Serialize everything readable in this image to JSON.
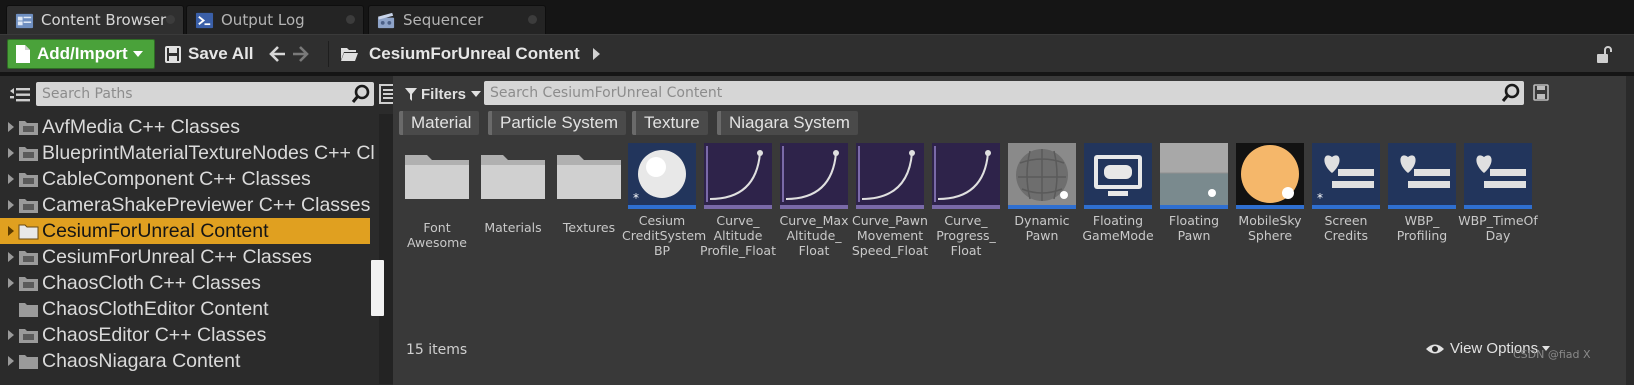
{
  "tabs": [
    {
      "label": "Content Browser",
      "active": true,
      "icon": "content-browser-icon"
    },
    {
      "label": "Output Log",
      "active": false,
      "icon": "output-log-icon"
    },
    {
      "label": "Sequencer",
      "active": false,
      "icon": "sequencer-icon"
    }
  ],
  "toolbar": {
    "add_import_label": "Add/Import",
    "save_all_label": "Save All",
    "breadcrumb": "CesiumForUnreal Content"
  },
  "path_panel": {
    "search_placeholder": "Search Paths",
    "items": [
      {
        "label": "AvfMedia C++ Classes",
        "type": "class",
        "expandable": true
      },
      {
        "label": "BlueprintMaterialTextureNodes C++ Cl",
        "type": "class",
        "expandable": true
      },
      {
        "label": "CableComponent C++ Classes",
        "type": "class",
        "expandable": true
      },
      {
        "label": "CameraShakePreviewer C++ Classes",
        "type": "class",
        "expandable": true
      },
      {
        "label": "CesiumForUnreal Content",
        "type": "folder",
        "expandable": true,
        "selected": true
      },
      {
        "label": "CesiumForUnreal C++ Classes",
        "type": "class",
        "expandable": true
      },
      {
        "label": "ChaosCloth C++ Classes",
        "type": "class",
        "expandable": true
      },
      {
        "label": "ChaosClothEditor Content",
        "type": "folder",
        "expandable": false
      },
      {
        "label": "ChaosEditor C++ Classes",
        "type": "class",
        "expandable": true
      },
      {
        "label": "ChaosNiagara Content",
        "type": "folder",
        "expandable": true
      }
    ]
  },
  "asset_panel": {
    "filters_label": "Filters",
    "search_placeholder": "Search CesiumForUnreal Content",
    "filter_chips": [
      "Material",
      "Particle System",
      "Texture",
      "Niagara System"
    ],
    "assets": [
      {
        "name": "Font\nAwesome",
        "kind": "folder"
      },
      {
        "name": "Materials",
        "kind": "folder"
      },
      {
        "name": "Textures",
        "kind": "folder"
      },
      {
        "name": "Cesium\nCreditSystem\nBP",
        "kind": "blueprint-sphere"
      },
      {
        "name": "Curve_\nAltitude\nProfile_Float",
        "kind": "curve"
      },
      {
        "name": "Curve_Max\nAltitude_\nFloat",
        "kind": "curve"
      },
      {
        "name": "Curve_Pawn\nMovement\nSpeed_Float",
        "kind": "curve"
      },
      {
        "name": "Curve_\nProgress_\nFloat",
        "kind": "curve"
      },
      {
        "name": "Dynamic\nPawn",
        "kind": "pawn-sphere"
      },
      {
        "name": "Floating\nGameMode",
        "kind": "gamemode"
      },
      {
        "name": "Floating\nPawn",
        "kind": "floor"
      },
      {
        "name": "MobileSky\nSphere",
        "kind": "sky-sphere"
      },
      {
        "name": "Screen\nCredits",
        "kind": "widget"
      },
      {
        "name": "WBP_\nProfiling",
        "kind": "widget"
      },
      {
        "name": "WBP_TimeOf\nDay",
        "kind": "widget"
      }
    ],
    "item_count": "15 items",
    "view_options_label": "View Options",
    "watermark": "CSDN @fiad X"
  },
  "colors": {
    "add_import_green": "#4aa23a",
    "selection_orange": "#e0a020",
    "panel_dark": "#2b2b2b",
    "asset_bg": "#393939",
    "asset_underline_blue": "#2f6fd0"
  }
}
